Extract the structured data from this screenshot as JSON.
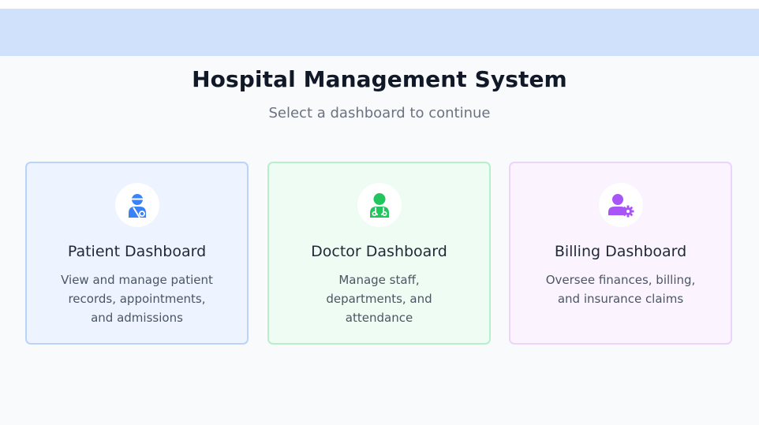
{
  "header": {
    "title": "Hospital Management System",
    "subtitle": "Select a dashboard to continue"
  },
  "cards": [
    {
      "title": "Patient Dashboard",
      "description": "View and manage patient records, appointments, and admissions",
      "icon": "patient-icon",
      "accent": "#3b82f6"
    },
    {
      "title": "Doctor Dashboard",
      "description": "Manage staff, departments, and attendance",
      "icon": "doctor-icon",
      "accent": "#22c55e"
    },
    {
      "title": "Billing Dashboard",
      "description": "Oversee finances, billing, and insurance claims",
      "icon": "billing-icon",
      "accent": "#a855f7"
    }
  ],
  "colors": {
    "banner": "#d0e1fc",
    "background": "#f8fafc"
  }
}
